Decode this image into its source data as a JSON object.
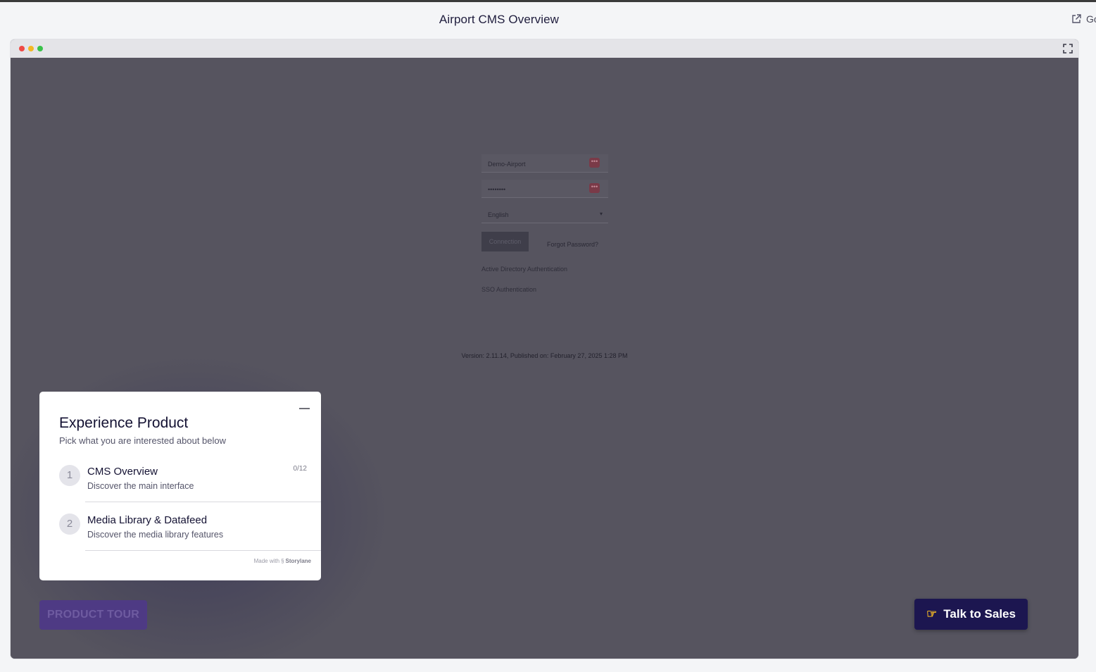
{
  "page": {
    "title": "Airport CMS Overview",
    "open_new_label": "Go"
  },
  "login": {
    "username_value": "Demo-Airport",
    "password_value": "••••••••",
    "language_value": "English",
    "connect_label": "Connection",
    "forgot_label": "Forgot Password?",
    "ad_auth_label": "Active Directory Authentication",
    "sso_auth_label": "SSO Authentication",
    "key_badge": "•••",
    "version_text": "Version: 2.11.14, Published on: February 27, 2025 1:28 PM"
  },
  "tour_card": {
    "title": "Experience Product",
    "subtitle": "Pick what you are interested about below",
    "items": [
      {
        "number": "1",
        "name": "CMS Overview",
        "description": "Discover the main interface",
        "progress": "0/12"
      },
      {
        "number": "2",
        "name": "Media Library & Datafeed",
        "description": "Discover the media library features"
      }
    ],
    "made_with_prefix": "Made with",
    "made_with_brand": "Storylane"
  },
  "buttons": {
    "product_tour": "PRODUCT TOUR",
    "talk_to_sales": "Talk to Sales"
  },
  "colors": {
    "accent_dark": "#1c1650",
    "overlay": "#56545f",
    "product_tour_bg": "#4e3a84"
  }
}
